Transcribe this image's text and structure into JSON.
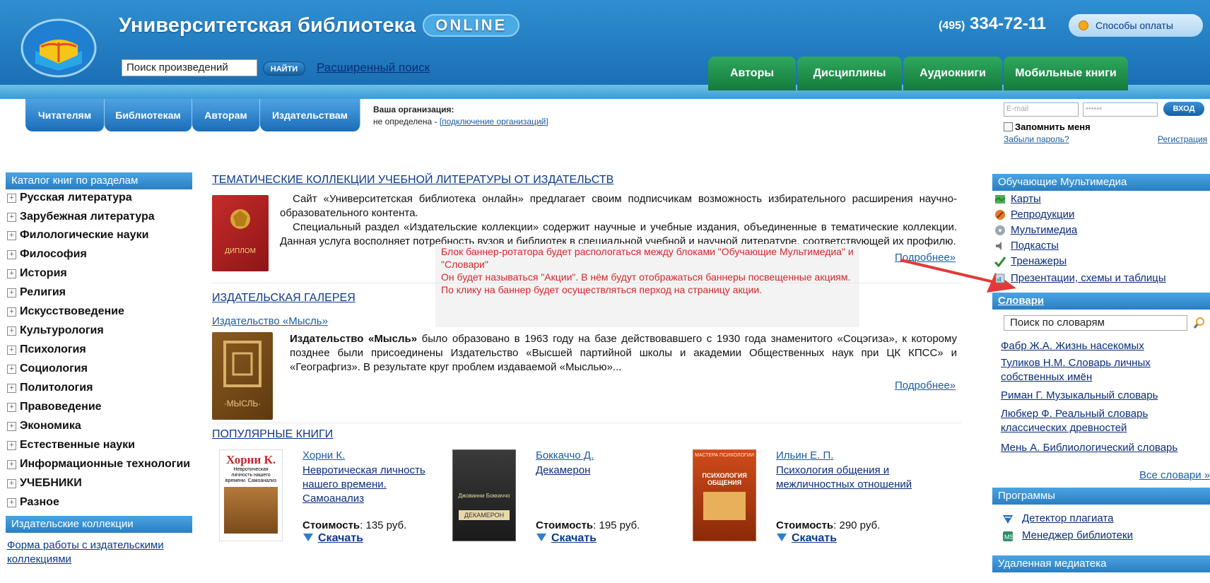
{
  "header": {
    "site_title": "Университетская библиотека",
    "online_badge": "ONLINE",
    "phone_code": "(495)",
    "phone_number": "334-72-11",
    "payment_link": "Способы оплаты",
    "search_placeholder": "Поиск произведений",
    "search_button": "НАЙТИ",
    "advanced_search": "Расширенный поиск",
    "main_tabs": [
      "Авторы",
      "Дисциплины",
      "Аудиокниги",
      "Мобильные книги"
    ],
    "accent_blue": "#2f8fd0",
    "tab_green": "#1f8f4a"
  },
  "subnav": {
    "tabs": [
      "Читателям",
      "Библиотекам",
      "Авторам",
      "Издательствам"
    ],
    "org_label": "Ваша организация:",
    "org_value": "не определена - ",
    "org_link": "[подключение организаций]"
  },
  "login": {
    "email_placeholder": "E-mail",
    "password_placeholder": "••••••",
    "login_button": "ВХОД",
    "remember_me": "Запомнить меня",
    "forgot_password": "Забыли пароль?",
    "register": "Регистрация"
  },
  "catalog": {
    "title": "Каталог книг по разделам",
    "items": [
      "Русская литература",
      "Зарубежная литература",
      "Филологические науки",
      "Философия",
      "История",
      "Религия",
      "Искусствоведение",
      "Культурология",
      "Психология",
      "Социология",
      "Политология",
      "Правоведение",
      "Экономика",
      "Естественные науки",
      "Информационные технологии",
      "УЧЕБНИКИ",
      "Разное"
    ]
  },
  "publisher_collections": {
    "title": "Издательские коллекции",
    "link": "Форма работы с издательскими коллекциями"
  },
  "thematic": {
    "title": "ТЕМАТИЧЕСКИЕ КОЛЛЕКЦИИ УЧЕБНОЙ ЛИТЕРАТУРЫ ОТ ИЗДАТЕЛЬСТВ",
    "cover_label": "ДИПЛОМ",
    "para1": "Сайт «Университетская библиотека онлайн» предлагает своим подписчикам возможность избирательного расширения научно-образовательного контента.",
    "para2": "Специальный раздел «Издательские коллекции» содержит научные и учебные издания, объединенные в тематические коллекции. Данная услуга восполняет потребность вузов и библиотек в специальной учебной и научной литературе, соответствующей их профилю.",
    "more": "Подробнее»"
  },
  "annotation": {
    "line1": "Блок баннер-ротатора будет распологаться между блоками \"Обучающие Мультимедиа\" и \"Словари\"",
    "line2": "Он будет называться \"Акции\". В нём будут отображаться баннеры посвещенные акциям. По клику на баннер будет осуществляться перход на страницу акции.",
    "color": "#d7262a"
  },
  "gallery": {
    "title": "ИЗДАТЕЛЬСКАЯ ГАЛЕРЕЯ",
    "publisher_link": "Издательство «Мысль»",
    "cover_label": "·МЫСЛЬ·",
    "text_bold": "Издательство «Мысль»",
    "text_rest": " было образовано в 1963 году на базе действовавшего с 1930 года знаменитого «Соцэгиза», к которому позднее были присоединены Издательство «Высшей партийной школы и академии Общественных наук при ЦК КПСС» и «Географгиз». В результате круг проблем издаваемой «Мыслью»...",
    "more": "Подробнее»"
  },
  "popular": {
    "title": "ПОПУЛЯРНЫЕ КНИГИ",
    "price_label": "Стоимость",
    "download_label": "Скачать",
    "books": [
      {
        "author": "Хорни К.",
        "title": "Невротическая личность нашего времени. Самоанализ",
        "price": ": 135 руб.",
        "cover_title": "Хорни К.",
        "cover_sub": "Невротическая личность нашего времени. Самоанализ"
      },
      {
        "author": "Боккаччо Д.",
        "title": "Декамерон",
        "price": ": 195 руб.",
        "cover_title": "ДЕКАМЕРОН",
        "cover_sub": "Джованни Боккаччо"
      },
      {
        "author": "Ильин Е. П.",
        "title": "Психология общения и межличностных отношений",
        "price": ": 290 руб.",
        "cover_title": "ПСИХОЛОГИЯ ОБЩЕНИЯ",
        "cover_sub": "МАСТЕРА ПСИХОЛОГИИ"
      }
    ]
  },
  "multimedia": {
    "title": "Обучающие Мультимедиа",
    "items": [
      "Карты",
      "Репродукции",
      "Мультимедиа",
      "Подкасты",
      "Тренажеры",
      "Презентации, схемы и таблицы"
    ]
  },
  "dictionaries": {
    "title": "Словари",
    "search_placeholder": "Поиск по словарям",
    "items": [
      "Фабр Ж.А. Жизнь насекомых",
      "Туликов Н.М. Словарь личных собственных имён",
      "Риман Г. Музыкальный словарь",
      "Любкер Ф. Реальный словарь классических древностей",
      "Мень А. Библиологический словарь"
    ],
    "all": "Все словари »"
  },
  "programs": {
    "title": "Программы",
    "items": [
      "Детектор плагиата",
      "Менеджер библиотеки"
    ]
  },
  "remote": {
    "title": "Удаленная медиатека"
  }
}
